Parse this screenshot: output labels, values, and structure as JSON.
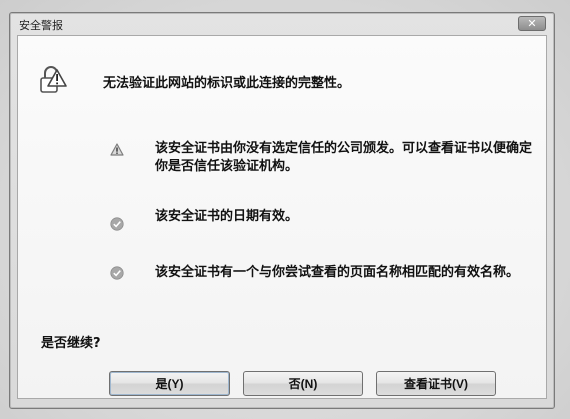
{
  "window": {
    "title": "安全警报",
    "close_label": "✕"
  },
  "message": {
    "headline": "无法验证此网站的标识或此连接的完整性。",
    "items": [
      {
        "icon": "warning-triangle-icon",
        "text": "该安全证书由你没有选定信任的公司颁发。可以查看证书以便确定你是否信任该验证机构。"
      },
      {
        "icon": "check-circle-icon",
        "text": "该安全证书的日期有效。"
      },
      {
        "icon": "check-circle-icon",
        "text": "该安全证书有一个与你尝试查看的页面名称相匹配的有效名称。"
      }
    ],
    "prompt": "是否继续?"
  },
  "buttons": {
    "yes": "是(Y)",
    "no": "否(N)",
    "view_cert": "查看证书(V)"
  },
  "colors": {
    "dialog_frame": "#7a7a7a",
    "content_bg": "#fbfbfb",
    "check_icon": "#9a9a9a",
    "warning_icon": "#8a8a8a"
  }
}
